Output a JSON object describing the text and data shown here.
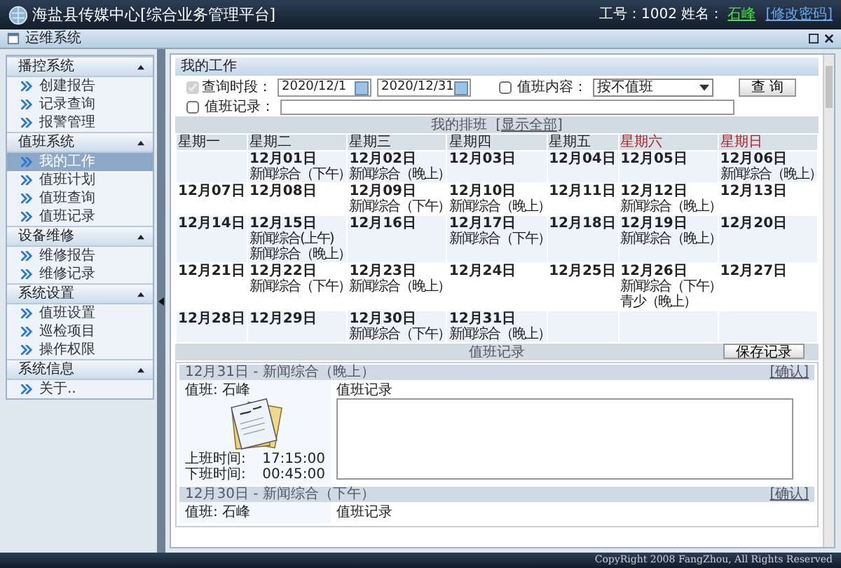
{
  "header": {
    "title": "海盐县传媒中心[综合业务管理平台]",
    "user_label": "工号：1002 姓名：",
    "user_name": "石峰",
    "change_password": "[修改密码]"
  },
  "window": {
    "title": "运维系统"
  },
  "sidebar": {
    "groups": [
      {
        "title": "播控系统",
        "expanded": true,
        "items": [
          {
            "label": "创建报告",
            "selected": false
          },
          {
            "label": "记录查询",
            "selected": false
          },
          {
            "label": "报警管理",
            "selected": false
          }
        ]
      },
      {
        "title": "值班系统",
        "expanded": true,
        "items": [
          {
            "label": "我的工作",
            "selected": true
          },
          {
            "label": "值班计划",
            "selected": false
          },
          {
            "label": "值班查询",
            "selected": false
          },
          {
            "label": "值班记录",
            "selected": false
          }
        ]
      },
      {
        "title": "设备维修",
        "expanded": true,
        "items": [
          {
            "label": "维修报告",
            "selected": false
          },
          {
            "label": "维修记录",
            "selected": false
          }
        ]
      },
      {
        "title": "系统设置",
        "expanded": true,
        "items": [
          {
            "label": "值班设置",
            "selected": false
          },
          {
            "label": "巡检项目",
            "selected": false
          },
          {
            "label": "操作权限",
            "selected": false
          }
        ]
      },
      {
        "title": "系统信息",
        "expanded": true,
        "items": [
          {
            "label": "关于..",
            "selected": false
          }
        ]
      }
    ]
  },
  "work": {
    "title": "我的工作",
    "filters": {
      "time_label": "查询时段：",
      "time_checked": true,
      "start_date": "2020/12/1",
      "end_date": "2020/12/31",
      "content_label": "值班内容：",
      "content_checked": false,
      "content_value": "按不值班",
      "record_label": "值班记录：",
      "record_checked": false,
      "search_button": "查 询"
    },
    "schedule": {
      "title": "我的排班",
      "show_all": "[显示全部]",
      "weekdays": [
        {
          "label": "星期一",
          "weekend": false
        },
        {
          "label": "星期二",
          "weekend": false
        },
        {
          "label": "星期三",
          "weekend": false
        },
        {
          "label": "星期四",
          "weekend": false
        },
        {
          "label": "星期五",
          "weekend": false
        },
        {
          "label": "星期六",
          "weekend": true
        },
        {
          "label": "星期日",
          "weekend": true
        }
      ],
      "weeks": [
        [
          {
            "blank": true
          },
          {
            "date": "12月01日",
            "shifts": [
              "新闻综合（下午）"
            ]
          },
          {
            "date": "12月02日",
            "shifts": [
              "新闻综合（晚上）"
            ]
          },
          {
            "date": "12月03日"
          },
          {
            "date": "12月04日"
          },
          {
            "date": "12月05日"
          },
          {
            "date": "12月06日",
            "shifts": [
              "新闻综合（晚上）"
            ]
          }
        ],
        [
          {
            "date": "12月07日"
          },
          {
            "date": "12月08日"
          },
          {
            "date": "12月09日",
            "shifts": [
              "新闻综合（下午）"
            ]
          },
          {
            "date": "12月10日",
            "shifts": [
              "新闻综合（晚上）"
            ]
          },
          {
            "date": "12月11日"
          },
          {
            "date": "12月12日",
            "shifts": [
              "新闻综合（晚上）"
            ]
          },
          {
            "date": "12月13日"
          }
        ],
        [
          {
            "date": "12月14日"
          },
          {
            "date": "12月15日",
            "shifts": [
              "新闻综合(上午)",
              "新闻综合（晚上）"
            ]
          },
          {
            "date": "12月16日"
          },
          {
            "date": "12月17日",
            "shifts": [
              "新闻综合（下午）"
            ]
          },
          {
            "date": "12月18日"
          },
          {
            "date": "12月19日",
            "shifts": [
              "新闻综合（晚上）"
            ]
          },
          {
            "date": "12月20日"
          }
        ],
        [
          {
            "date": "12月21日"
          },
          {
            "date": "12月22日",
            "shifts": [
              "新闻综合（下午）"
            ]
          },
          {
            "date": "12月23日",
            "shifts": [
              "新闻综合（晚上）"
            ]
          },
          {
            "date": "12月24日"
          },
          {
            "date": "12月25日"
          },
          {
            "date": "12月26日",
            "shifts": [
              "新闻综合（下午）",
              "青少（晚上）"
            ]
          },
          {
            "date": "12月27日"
          }
        ],
        [
          {
            "date": "12月28日"
          },
          {
            "date": "12月29日"
          },
          {
            "date": "12月30日",
            "shifts": [
              "新闻综合（下午）"
            ]
          },
          {
            "date": "12月31日",
            "shifts": [
              "新闻综合（晚上）"
            ]
          },
          {
            "blank": true
          },
          {
            "blank": true
          },
          {
            "blank": true
          }
        ]
      ]
    },
    "records": {
      "title": "值班记录",
      "save_button": "保存记录",
      "items": [
        {
          "heading": "12月31日 - 新闻综合（晚上）",
          "confirm": "[确认]",
          "duty": "值班: 石峰",
          "notes_label": "值班记录",
          "start_label": "上班时间:",
          "start_time": "17:15:00",
          "end_label": "下班时间:",
          "end_time": "00:45:00"
        },
        {
          "heading": "12月30日 - 新闻综合（下午）",
          "confirm": "[确认]",
          "duty": "值班: 石峰",
          "notes_label": "值班记录"
        }
      ]
    }
  },
  "footer": {
    "copyright": "CopyRight 2008 FangZhou, All Rights Reserved"
  }
}
